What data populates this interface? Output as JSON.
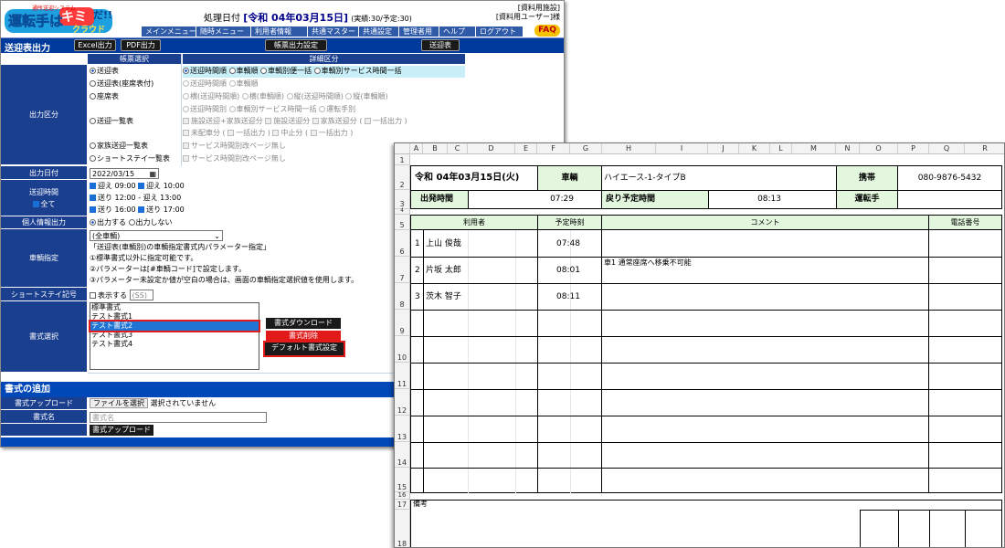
{
  "app": {
    "logo_top": "通所送迎システム",
    "logo_main": "運転手はキミだ!!",
    "logo_sub": "クラウド",
    "proc_label": "処理日付",
    "proc_date": "[令和 04年03月15日]",
    "proc_stats": "(実績:30/予定:30)",
    "facility": "[資料用施設]",
    "user": "[資料用ユーザー]様",
    "faq": "FAQ",
    "menu": [
      "メインメニュー",
      "随時メニュー",
      "利用者情報",
      "共通マスター",
      "共通設定",
      "管理者用",
      "ヘルプ",
      "ログアウト"
    ]
  },
  "toolbar": {
    "title": "送迎表出力",
    "excel": "Excel出力",
    "pdf": "PDF出力",
    "form_settings": "帳票出力設定",
    "transport_table": "送迎表"
  },
  "form": {
    "hdr_select": "帳票選択",
    "hdr_detail": "詳細区分",
    "label_output": "出力区分",
    "options": [
      {
        "label": "送迎表",
        "checked": true
      },
      {
        "label": "送迎表(座席表付)",
        "checked": false
      },
      {
        "label": "座席表",
        "checked": false
      },
      {
        "label": "送迎一覧表",
        "checked": false
      },
      {
        "label": "家族送迎一覧表",
        "checked": false
      },
      {
        "label": "ショートステイ一覧表",
        "checked": false
      }
    ],
    "detail_row1": [
      "送迎時間順",
      "車輌順",
      "車輌別便一括",
      "車輌別サービス時間一括"
    ],
    "detail_row2": [
      "送迎時間順",
      "車輌順"
    ],
    "detail_row3": [
      "横(送迎時間順)",
      "横(車輌順)",
      "縦(送迎時間順)",
      "縦(車輌順)"
    ],
    "detail_row4a": [
      "送迎時間別",
      "車輌別サービス時間一括",
      "運転手別"
    ],
    "detail_row4b": [
      "施設送迎+家族送迎分",
      "施設送迎分",
      "家族送迎分 (",
      "一括出力 )"
    ],
    "detail_row4c": [
      "未配車分 (",
      "一括出力 )",
      "中止分 (",
      "一括出力 )"
    ],
    "detail_family": "サービス時間別改ページ無し",
    "detail_short": "サービス時間別改ページ無し",
    "label_date": "出力日付",
    "date_value": "2022/03/15",
    "label_time": "送迎時間",
    "all_label": "全て",
    "times": [
      "迎え 09:00",
      "迎え 10:00",
      "送り 12:00 - 迎え 13:00",
      "送り 16:00",
      "送り 17:00"
    ],
    "label_personal": "個人情報出力",
    "personal_yes": "出力する",
    "personal_no": "出力しない",
    "label_vehicle": "車輌指定",
    "vehicle_value": "(全車輌)",
    "vehicle_notes": [
      "「送迎表(車輌別)の車輌指定書式内パラメーター指定」",
      "①標準書式以外に指定可能です。",
      "②パラメーターは[#車輌コード]で設定します。",
      "③パラメーター未設定か値が空白の場合は、画面の車輌指定選択値を使用します。"
    ],
    "label_short": "ショートステイ記号",
    "short_show": "表示する",
    "short_code": "(SS)",
    "label_format": "書式選択",
    "formats": [
      "標準書式",
      "テスト書式1",
      "テスト書式2",
      "テスト書式3",
      "テスト書式4"
    ],
    "btn_download": "書式ダウンロード",
    "btn_delete": "書式削除",
    "btn_default": "デフォルト書式設定"
  },
  "add": {
    "title": "書式の追加",
    "label_upload": "書式アップロード",
    "file_btn": "ファイルを選択",
    "file_none": "選択されていません",
    "label_name": "書式名",
    "name_placeholder": "書式名",
    "upload_btn": "書式アップロード"
  },
  "sheet": {
    "cols": [
      "A",
      "B",
      "C",
      "D",
      "E",
      "F",
      "G",
      "H",
      "I",
      "J",
      "K",
      "L",
      "M",
      "N",
      "O",
      "P",
      "Q",
      "R"
    ],
    "rows": [
      "1",
      "2",
      "3",
      "4",
      "5",
      "6",
      "7",
      "8",
      "9",
      "10",
      "11",
      "12",
      "13",
      "14",
      "15",
      "16",
      "17",
      "18"
    ],
    "date": "令和 04年03月15日(火)",
    "vehicle_label": "車輌",
    "vehicle_value": "ハイエース-1-タイプB",
    "mobile_label": "携帯",
    "mobile_value": "080-9876-5432",
    "depart_label": "出発時間",
    "depart_value": "07:29",
    "return_label": "戻り予定時間",
    "return_value": "08:13",
    "driver_label": "運転手",
    "head_user": "利用者",
    "head_time": "予定時刻",
    "head_comment": "コメント",
    "head_phone": "電話番号",
    "entries": [
      {
        "no": "1",
        "name": "上山 俊哉",
        "time": "07:48",
        "comment": ""
      },
      {
        "no": "2",
        "name": "片坂 太郎",
        "time": "08:01",
        "comment": "車1 通常座席へ移乗不可能"
      },
      {
        "no": "3",
        "name": "茨木 智子",
        "time": "08:11",
        "comment": ""
      }
    ],
    "remarks": "備考"
  }
}
